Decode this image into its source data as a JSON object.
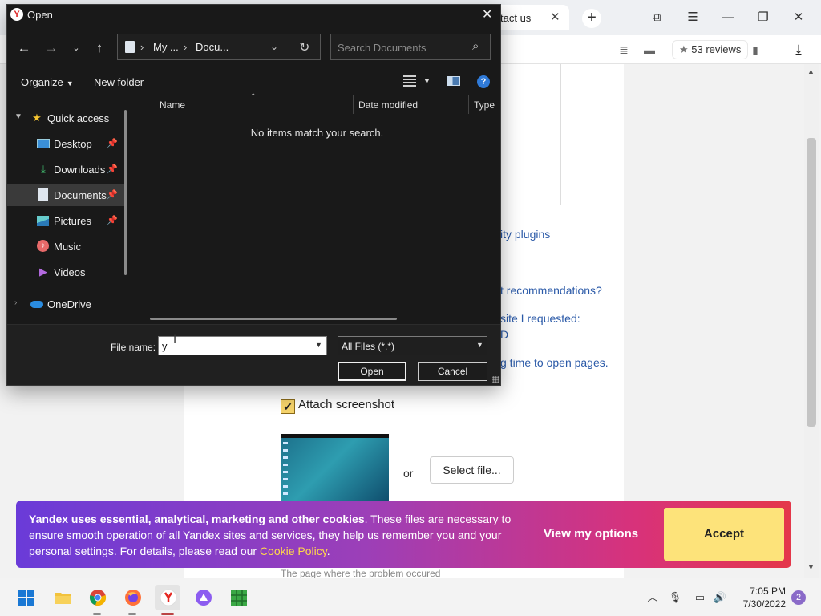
{
  "browser": {
    "tab_title": "tact us",
    "tab_close": "✕",
    "new_tab": "+",
    "reviews": "53 reviews",
    "window_controls": {
      "collections": "⧉",
      "menu": "☰",
      "minimize": "—",
      "maximize": "❐",
      "close": "✕"
    }
  },
  "page": {
    "links": [
      "ity plugins",
      "t recommendations?",
      "site I requested:",
      "D",
      "g time to open pages."
    ],
    "attach_label": "Attach screenshot",
    "attach_checked": true,
    "or_label": "or",
    "select_file_label": "Select file...",
    "footer_text": "The page where the problem occured"
  },
  "cookie_banner": {
    "bold_text": "Yandex uses essential, analytical, marketing and other cookies",
    "body_text": ". These files are necessary to ensure smooth operation of all Yandex sites and services, they help us remember you and your personal settings. For details, please read our ",
    "link_text": "Cookie Policy",
    "end_text": ".",
    "options_label": "View my options",
    "accept_label": "Accept",
    "accent_color": "#fde37a",
    "link_color": "#ffd84a"
  },
  "dialog": {
    "title": "Open",
    "address": {
      "segments": [
        "My ...",
        "Docu..."
      ]
    },
    "search_placeholder": "Search Documents",
    "commands": {
      "organize": "Organize",
      "new_folder": "New folder"
    },
    "nav_items": [
      {
        "label": "Quick access",
        "icon": "star-icon"
      },
      {
        "label": "Desktop",
        "icon": "desktop-icon",
        "pinned": true
      },
      {
        "label": "Downloads",
        "icon": "download-icon",
        "pinned": true
      },
      {
        "label": "Documents",
        "icon": "documents-icon",
        "pinned": true,
        "selected": true
      },
      {
        "label": "Pictures",
        "icon": "pictures-icon",
        "pinned": true
      },
      {
        "label": "Music",
        "icon": "music-icon"
      },
      {
        "label": "Videos",
        "icon": "videos-icon"
      },
      {
        "label": "OneDrive",
        "icon": "cloud-icon"
      }
    ],
    "columns": [
      "Name",
      "Date modified",
      "Type"
    ],
    "empty_message": "No items match your search.",
    "file_name_label": "File name:",
    "file_name_value": "y",
    "filter_value": "All Files (*.*)",
    "open_label": "Open",
    "cancel_label": "Cancel"
  },
  "taskbar": {
    "apps": [
      "windows-start",
      "file-explorer",
      "chrome",
      "firefox",
      "yandex-browser",
      "alice",
      "minesweeper"
    ],
    "active_app": "yandex-browser",
    "time": "7:05 PM",
    "date": "7/30/2022",
    "notification_count": "2"
  }
}
